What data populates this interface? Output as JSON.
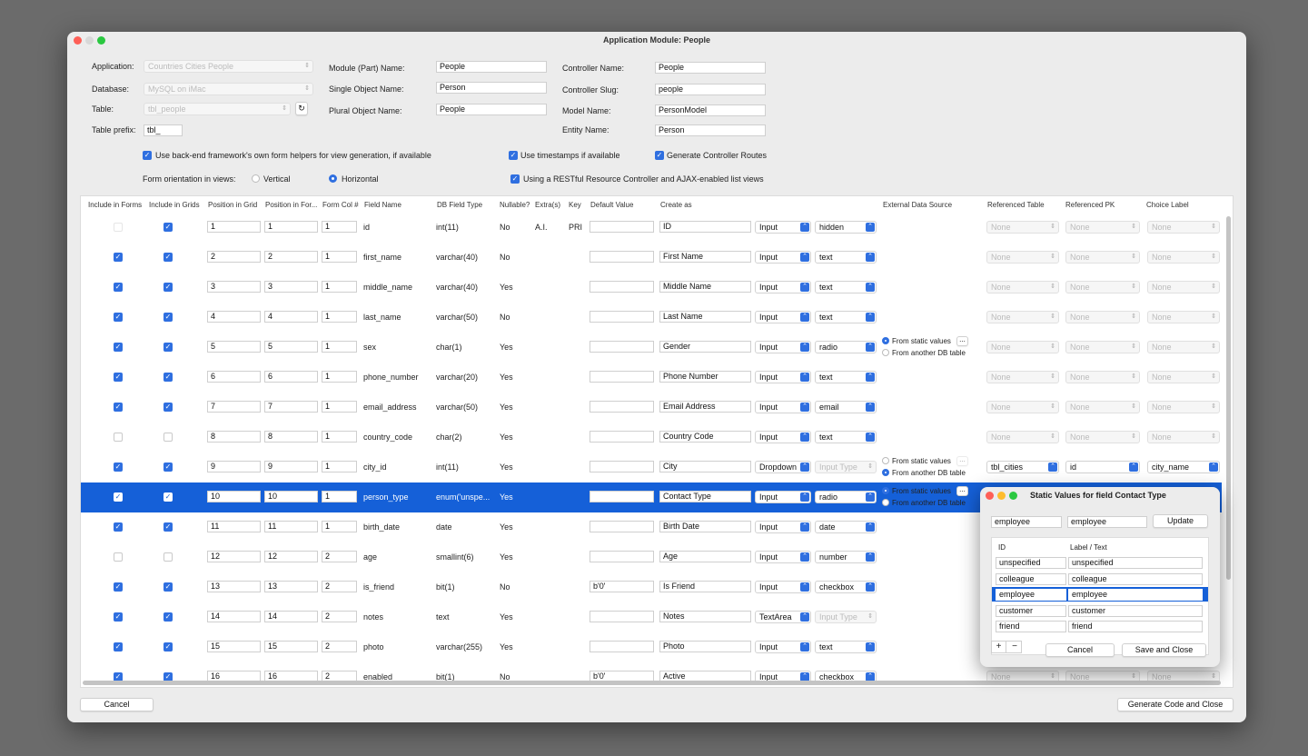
{
  "window": {
    "title": "Application Module: People"
  },
  "form": {
    "application_label": "Application:",
    "application_value": "Countries Cities People",
    "database_label": "Database:",
    "database_value": "MySQL on iMac",
    "table_label": "Table:",
    "table_value": "tbl_people",
    "prefix_label": "Table prefix:",
    "prefix_value": "tbl_",
    "module_label": "Module (Part) Name:",
    "module_value": "People",
    "single_label": "Single Object Name:",
    "single_value": "Person",
    "plural_label": "Plural Object Name:",
    "plural_value": "People",
    "controller_label": "Controller Name:",
    "controller_value": "People",
    "slug_label": "Controller Slug:",
    "slug_value": "people",
    "model_label": "Model Name:",
    "model_value": "PersonModel",
    "entity_label": "Entity Name:",
    "entity_value": "Person",
    "opt_backend": "Use back-end framework's own form helpers for view generation, if available",
    "opt_timestamps": "Use timestamps if available",
    "opt_routes": "Generate Controller Routes",
    "orientation_label": "Form orientation in views:",
    "orient_vertical": "Vertical",
    "orient_horizontal": "Horizontal",
    "opt_restful": "Using a RESTful Resource Controller and AJAX-enabled list views"
  },
  "headers": [
    "Include in Forms",
    "Include in Grids",
    "Position in Grid",
    "Position in For...",
    "Form Col #",
    "Field Name",
    "DB Field Type",
    "Nullable?",
    "Extra(s)",
    "Key",
    "Default Value",
    "Create as",
    "External Data Source",
    "Referenced Table",
    "Referenced PK",
    "Choice Label"
  ],
  "rows": [
    {
      "f": false,
      "fdis": true,
      "g": true,
      "pg": "1",
      "pf": "1",
      "col": "1",
      "name": "id",
      "type": "int(11)",
      "nul": "No",
      "extra": "A.I.",
      "key": "PRI",
      "def": "",
      "label": "ID",
      "ctl": "Input",
      "sub": "hidden",
      "subdis": false,
      "ext": "",
      "rt": "None",
      "rpk": "None",
      "cl": "None",
      "rdis": true
    },
    {
      "f": true,
      "g": true,
      "pg": "2",
      "pf": "2",
      "col": "1",
      "name": "first_name",
      "type": "varchar(40)",
      "nul": "No",
      "extra": "",
      "key": "",
      "def": "",
      "label": "First Name",
      "ctl": "Input",
      "sub": "text",
      "subdis": false,
      "ext": "",
      "rt": "None",
      "rpk": "None",
      "cl": "None",
      "rdis": true
    },
    {
      "f": true,
      "g": true,
      "pg": "3",
      "pf": "3",
      "col": "1",
      "name": "middle_name",
      "type": "varchar(40)",
      "nul": "Yes",
      "extra": "",
      "key": "",
      "def": "",
      "label": "Middle Name",
      "ctl": "Input",
      "sub": "text",
      "subdis": false,
      "ext": "",
      "rt": "None",
      "rpk": "None",
      "cl": "None",
      "rdis": true
    },
    {
      "f": true,
      "g": true,
      "pg": "4",
      "pf": "4",
      "col": "1",
      "name": "last_name",
      "type": "varchar(50)",
      "nul": "No",
      "extra": "",
      "key": "",
      "def": "",
      "label": "Last Name",
      "ctl": "Input",
      "sub": "text",
      "subdis": false,
      "ext": "",
      "rt": "None",
      "rpk": "None",
      "cl": "None",
      "rdis": true
    },
    {
      "f": true,
      "g": true,
      "pg": "5",
      "pf": "5",
      "col": "1",
      "name": "sex",
      "type": "char(1)",
      "nul": "Yes",
      "extra": "",
      "key": "",
      "def": "",
      "label": "Gender",
      "ctl": "Input",
      "sub": "radio",
      "subdis": false,
      "ext": "static",
      "rt": "None",
      "rpk": "None",
      "cl": "None",
      "rdis": true
    },
    {
      "f": true,
      "g": true,
      "pg": "6",
      "pf": "6",
      "col": "1",
      "name": "phone_number",
      "type": "varchar(20)",
      "nul": "Yes",
      "extra": "",
      "key": "",
      "def": "",
      "label": "Phone Number",
      "ctl": "Input",
      "sub": "text",
      "subdis": false,
      "ext": "",
      "rt": "None",
      "rpk": "None",
      "cl": "None",
      "rdis": true
    },
    {
      "f": true,
      "g": true,
      "pg": "7",
      "pf": "7",
      "col": "1",
      "name": "email_address",
      "type": "varchar(50)",
      "nul": "Yes",
      "extra": "",
      "key": "",
      "def": "",
      "label": "Email Address",
      "ctl": "Input",
      "sub": "email",
      "subdis": false,
      "ext": "",
      "rt": "None",
      "rpk": "None",
      "cl": "None",
      "rdis": true
    },
    {
      "f": false,
      "g": false,
      "pg": "8",
      "pf": "8",
      "col": "1",
      "name": "country_code",
      "type": "char(2)",
      "nul": "Yes",
      "extra": "",
      "key": "",
      "def": "",
      "label": "Country Code",
      "ctl": "Input",
      "sub": "text",
      "subdis": false,
      "ext": "",
      "rt": "None",
      "rpk": "None",
      "cl": "None",
      "rdis": true
    },
    {
      "f": true,
      "g": true,
      "pg": "9",
      "pf": "9",
      "col": "1",
      "name": "city_id",
      "type": "int(11)",
      "nul": "Yes",
      "extra": "",
      "key": "",
      "def": "",
      "label": "City",
      "ctl": "Dropdown",
      "sub": "Input Type",
      "subdis": true,
      "ext": "db",
      "rt": "tbl_cities",
      "rpk": "id",
      "cl": "city_name",
      "rdis": false
    },
    {
      "f": true,
      "g": true,
      "pg": "10",
      "pf": "10",
      "col": "1",
      "name": "person_type",
      "type": "enum('unspe...",
      "nul": "Yes",
      "extra": "",
      "key": "",
      "def": "",
      "label": "Contact Type",
      "ctl": "Input",
      "sub": "radio",
      "subdis": false,
      "ext": "static",
      "rt": "None",
      "rpk": "None",
      "cl": "None",
      "rdis": true,
      "sel": true
    },
    {
      "f": true,
      "g": true,
      "pg": "11",
      "pf": "11",
      "col": "1",
      "name": "birth_date",
      "type": "date",
      "nul": "Yes",
      "extra": "",
      "key": "",
      "def": "",
      "label": "Birth Date",
      "ctl": "Input",
      "sub": "date",
      "subdis": false,
      "ext": "",
      "rt": "None",
      "rpk": "None",
      "cl": "None",
      "rdis": true
    },
    {
      "f": false,
      "g": false,
      "pg": "12",
      "pf": "12",
      "col": "2",
      "name": "age",
      "type": "smallint(6)",
      "nul": "Yes",
      "extra": "",
      "key": "",
      "def": "",
      "label": "Age",
      "ctl": "Input",
      "sub": "number",
      "subdis": false,
      "ext": "",
      "rt": "None",
      "rpk": "None",
      "cl": "None",
      "rdis": true
    },
    {
      "f": true,
      "g": true,
      "pg": "13",
      "pf": "13",
      "col": "2",
      "name": "is_friend",
      "type": "bit(1)",
      "nul": "No",
      "extra": "",
      "key": "",
      "def": "b'0'",
      "label": "Is Friend",
      "ctl": "Input",
      "sub": "checkbox",
      "subdis": false,
      "ext": "",
      "rt": "None",
      "rpk": "None",
      "cl": "None",
      "rdis": true
    },
    {
      "f": true,
      "g": true,
      "pg": "14",
      "pf": "14",
      "col": "2",
      "name": "notes",
      "type": "text",
      "nul": "Yes",
      "extra": "",
      "key": "",
      "def": "",
      "label": "Notes",
      "ctl": "TextArea",
      "sub": "Input Type",
      "subdis": true,
      "ext": "",
      "rt": "None",
      "rpk": "None",
      "cl": "None",
      "rdis": true
    },
    {
      "f": true,
      "g": true,
      "pg": "15",
      "pf": "15",
      "col": "2",
      "name": "photo",
      "type": "varchar(255)",
      "nul": "Yes",
      "extra": "",
      "key": "",
      "def": "",
      "label": "Photo",
      "ctl": "Input",
      "sub": "text",
      "subdis": false,
      "ext": "",
      "rt": "None",
      "rpk": "None",
      "cl": "None",
      "rdis": true
    },
    {
      "f": true,
      "g": true,
      "pg": "16",
      "pf": "16",
      "col": "2",
      "name": "enabled",
      "type": "bit(1)",
      "nul": "No",
      "extra": "",
      "key": "",
      "def": "b'0'",
      "label": "Active",
      "ctl": "Input",
      "sub": "checkbox",
      "subdis": false,
      "ext": "",
      "rt": "None",
      "rpk": "None",
      "cl": "None",
      "rdis": true
    }
  ],
  "ext_source": {
    "static": "From static values",
    "db": "From another DB table",
    "more": "..."
  },
  "footer": {
    "cancel": "Cancel",
    "generate": "Generate Code and Close"
  },
  "dialog": {
    "title": "Static Values for field Contact Type",
    "id_input": "employee",
    "label_input": "employee",
    "update": "Update",
    "col_id": "ID",
    "col_label": "Label / Text",
    "values": [
      {
        "id": "unspecified",
        "label": "unspecified"
      },
      {
        "id": "colleague",
        "label": "colleague"
      },
      {
        "id": "employee",
        "label": "employee",
        "sel": true
      },
      {
        "id": "customer",
        "label": "customer"
      },
      {
        "id": "friend",
        "label": "friend"
      }
    ],
    "add": "+",
    "remove": "−",
    "cancel": "Cancel",
    "save": "Save and Close"
  },
  "colors": {
    "accent": "#2f6fe0",
    "selection": "#1560d8"
  }
}
